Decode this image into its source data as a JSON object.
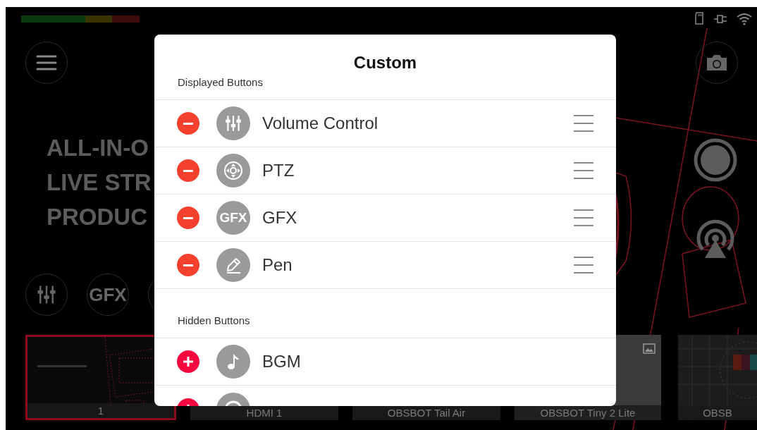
{
  "headline_lines": [
    "ALL-IN-O",
    "LIVE STR",
    "PRODUC"
  ],
  "side_buttons": [
    {
      "kind": "sliders"
    },
    {
      "kind": "text",
      "text": "GFX"
    },
    {
      "kind": "partial"
    }
  ],
  "sources": [
    {
      "label": "1",
      "selected": true,
      "kind": "picture"
    },
    {
      "label": "HDMI 1",
      "selected": false,
      "kind": "plain"
    },
    {
      "label": "OBSBOT Tail Air",
      "selected": false,
      "kind": "plain"
    },
    {
      "label": "OBSBOT Tiny 2 Lite",
      "selected": false,
      "kind": "placeholder"
    },
    {
      "label": "OBSB",
      "selected": false,
      "kind": "picture"
    }
  ],
  "dialog": {
    "title": "Custom",
    "sections": [
      {
        "heading": "Displayed Buttons",
        "kind": "displayed",
        "items": [
          {
            "label": "Volume Control"
          },
          {
            "label": "PTZ"
          },
          {
            "label": "GFX",
            "icon_text": "GFX"
          },
          {
            "label": "Pen"
          }
        ]
      },
      {
        "heading": "Hidden Buttons",
        "kind": "hidden",
        "items": [
          {
            "label": "BGM",
            "cut_off": false
          },
          {
            "cut_off": true
          }
        ]
      }
    ]
  }
}
